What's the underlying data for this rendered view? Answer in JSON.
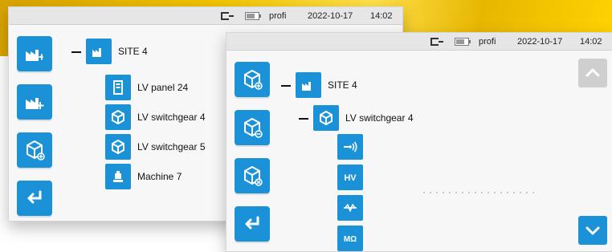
{
  "status": {
    "user": "profi",
    "date": "2022-10-17",
    "time": "14:02"
  },
  "screen1": {
    "tree": {
      "root": {
        "label": "SITE 4",
        "icon": "factory-icon"
      },
      "children": [
        {
          "label": "LV panel 24",
          "icon": "panel-icon"
        },
        {
          "label": "LV switchgear 4",
          "icon": "cube-icon"
        },
        {
          "label": "LV switchgear 5",
          "icon": "cube-icon"
        },
        {
          "label": "Machine 7",
          "icon": "machine-icon"
        }
      ]
    }
  },
  "screen2": {
    "tree": {
      "root": {
        "label": "SITE 4",
        "icon": "factory-icon"
      },
      "child": {
        "label": "LV switchgear 4",
        "icon": "cube-icon"
      },
      "measurements": [
        {
          "label": "",
          "icon": "signal-icon"
        },
        {
          "label": "HV",
          "icon": "hv-icon"
        },
        {
          "label": "",
          "icon": "waveform-icon"
        },
        {
          "label": "MΩ",
          "icon": "megaohm-icon"
        }
      ]
    }
  },
  "colors": {
    "accent_blue": "#1b92d7",
    "status_bar": "#e6e6e6",
    "background_yellow": "#f1c400"
  }
}
